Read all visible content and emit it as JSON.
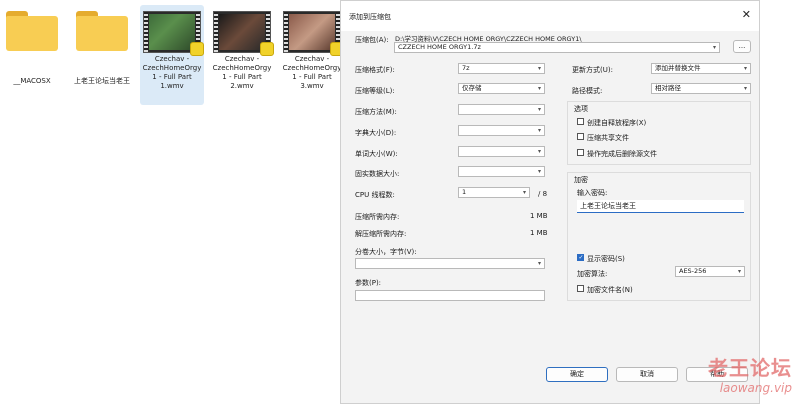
{
  "explorer": {
    "files": [
      {
        "name": "__MACOSX",
        "kind": "folder"
      },
      {
        "name": "上老王论坛当老王",
        "kind": "folder"
      },
      {
        "name": "Czechav - CzechHomeOrgy 1 - Full Part 1.wmv",
        "kind": "video",
        "selected": true
      },
      {
        "name": "Czechav - CzechHomeOrgy 1 - Full Part 2.wmv",
        "kind": "video"
      },
      {
        "name": "Czechav - CzechHomeOrgy 1 - Full Part 3.wmv",
        "kind": "video"
      }
    ]
  },
  "dialog": {
    "title": "添加到压缩包",
    "close_icon": "close-icon",
    "archive_label": "压缩包(A):",
    "archive_dir": "D:\\学习资料\\V\\CZECH HOME ORGY\\CZZECH HOME ORGY1\\",
    "archive_name": "CZZECH HOME ORGY1.7z",
    "browse_label": "...",
    "format_label": "压缩格式(F):",
    "format_value": "7z",
    "level_label": "压缩等级(L):",
    "level_value": "仅存储",
    "method_label": "压缩方法(M):",
    "method_value": "",
    "dict_label": "字典大小(D):",
    "dict_value": "",
    "word_label": "单词大小(W):",
    "word_value": "",
    "solid_label": "固实数据大小:",
    "solid_value": "",
    "threads_label": "CPU 线程数:",
    "threads_value": "1",
    "threads_total": "/ 8",
    "mem_compress_label": "压缩所需内存:",
    "mem_compress_value": "1 MB",
    "mem_decompress_label": "解压缩所需内存:",
    "mem_decompress_value": "1 MB",
    "volume_label": "分卷大小，字节(V):",
    "volume_value": "",
    "params_label": "参数(P):",
    "params_value": "",
    "update_label": "更新方式(U):",
    "update_value": "添加并替换文件",
    "path_label": "路径模式:",
    "path_value": "相对路径",
    "options": {
      "title": "选项",
      "items": [
        {
          "label": "创建自释放程序(X)",
          "checked": false
        },
        {
          "label": "压缩共享文件",
          "checked": false
        },
        {
          "label": "操作完成后删除源文件",
          "checked": false
        }
      ]
    },
    "encryption": {
      "title": "加密",
      "password_label": "输入密码:",
      "password_value": "上老王论坛当老王",
      "show_password_label": "显示密码(S)",
      "show_password_checked": true,
      "method_label": "加密算法:",
      "method_value": "AES-256",
      "encrypt_names_label": "加密文件名(N)",
      "encrypt_names_checked": false
    },
    "ok_label": "确定",
    "cancel_label": "取消",
    "help_label": "帮助"
  },
  "watermark": {
    "line1": "老王论坛",
    "line2": "laowang.vip"
  }
}
